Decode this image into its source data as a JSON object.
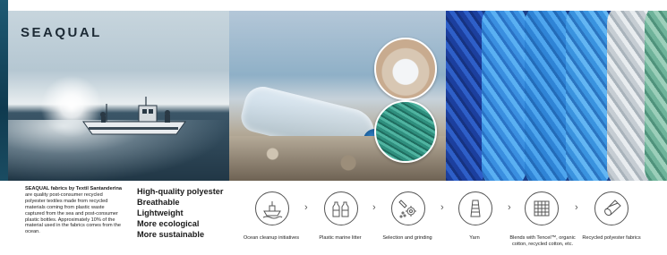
{
  "brand": {
    "name": "SEAQUAL"
  },
  "description": {
    "bold": "SEAQUAL fabrics by Textil Santanderina",
    "rest": "are quality post-consumer recycled polyester textiles made from recycled materials coming from plastic waste captured from the sea and post-consumer plastic bottles. Approximately 10% of the material used in the fabrics comes from the ocean."
  },
  "benefits": [
    "High-quality polyester",
    "Breathable",
    "Lightweight",
    "More ecological",
    "More sustainable"
  ],
  "process": {
    "arrow": "›",
    "steps": [
      {
        "label": "Ocean cleanup initiatives",
        "icon": "boat-icon"
      },
      {
        "label": "Plastic marine litter",
        "icon": "bottles-icon"
      },
      {
        "label": "Selection and grinding",
        "icon": "grinding-icon"
      },
      {
        "label": "Yarn",
        "icon": "yarn-spool-icon"
      },
      {
        "label": "Blends with Tencel™, organic cotton, recycled cotton, etc.",
        "icon": "fabric-grid-icon"
      },
      {
        "label": "Recycled polyester fabrics",
        "icon": "fabric-roll-icon"
      }
    ]
  },
  "colors": {
    "text": "#222222",
    "icon_stroke": "#555555",
    "yarn_blue": "#3a8fe0",
    "sea_teal": "#1f5a73"
  }
}
